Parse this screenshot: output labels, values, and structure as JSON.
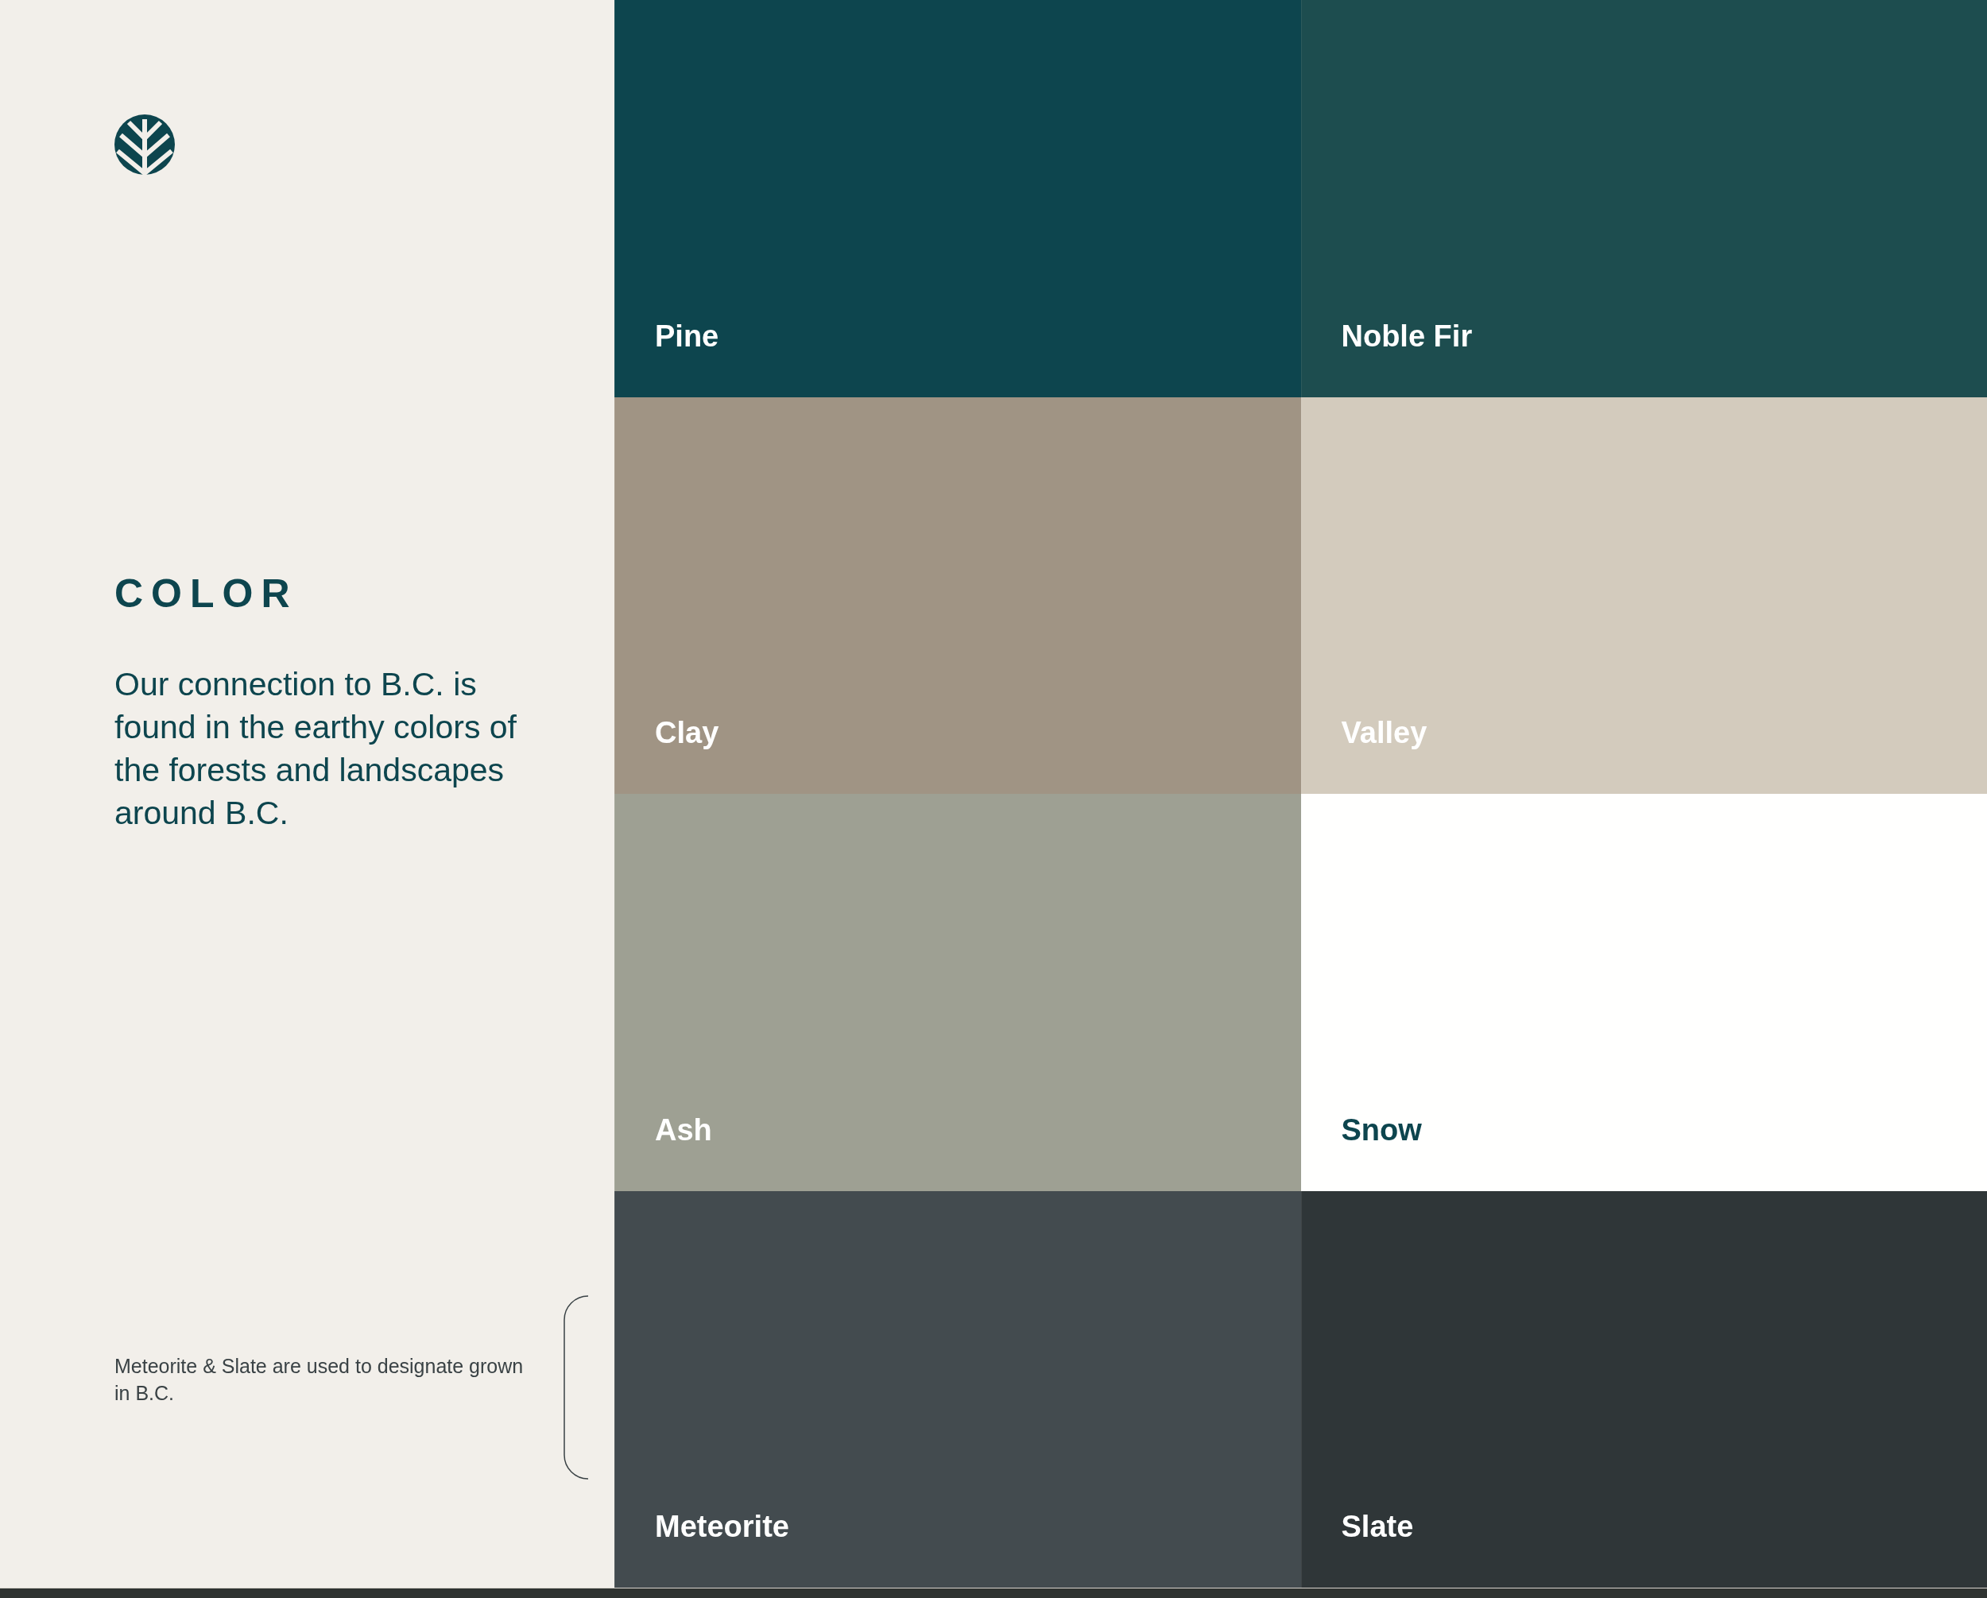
{
  "heading": "COLOR",
  "intro": "Our connection to B.C. is found in the earthy colors of the forests and landscapes around B.C.",
  "note": "Meteorite & Slate are used to designate grown in B.C.",
  "swatches": [
    {
      "name": "Pine",
      "color": "#0d454e",
      "kind": "dark"
    },
    {
      "name": "Noble Fir",
      "color": "#1d4d4f",
      "kind": "dark"
    },
    {
      "name": "Clay",
      "color": "#a09484",
      "kind": "dark"
    },
    {
      "name": "Valley",
      "color": "#d3cbbd",
      "kind": "dark"
    },
    {
      "name": "Ash",
      "color": "#9ea093",
      "kind": "dark"
    },
    {
      "name": "Snow",
      "color": "#fffffe",
      "kind": "light"
    },
    {
      "name": "Meteorite",
      "color": "#434b4f",
      "kind": "dark"
    },
    {
      "name": "Slate",
      "color": "#2f3638",
      "kind": "dark"
    }
  ]
}
